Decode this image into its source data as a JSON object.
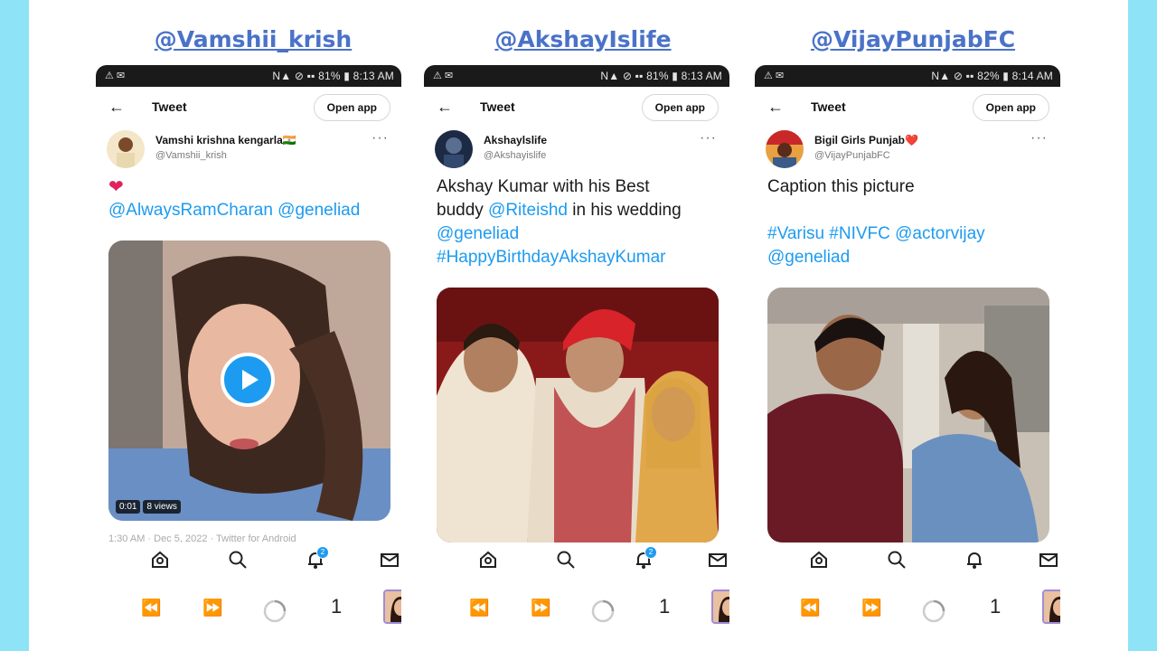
{
  "accent_color": "#1d9bf0",
  "handles": [
    "@Vamshii_krish",
    "@AkshayIslife",
    "@VijayPunjabFC"
  ],
  "phones": [
    {
      "status": {
        "left": "⚠ ✉",
        "right": "N▲ ⊘ ▪▪ 81% ▮ 8:13 AM"
      },
      "topbar": {
        "title": "Tweet",
        "open_app": "Open app"
      },
      "author": {
        "name": "Vamshi krishna kengarla🇮🇳",
        "handle": "@Vamshii_krish"
      },
      "text": {
        "heart": "❤",
        "line1": "@AlwaysRamCharan  @geneliad"
      },
      "video": {
        "duration": "0:01",
        "views": "8 views"
      },
      "timestamp": "1:30 AM · Dec 5, 2022 · Twitter for Android",
      "nav": {
        "notif_count": "2"
      },
      "system": {
        "count": "1"
      }
    },
    {
      "status": {
        "left": "⚠ ✉",
        "right": "N▲ ⊘ ▪▪ 81% ▮ 8:13 AM"
      },
      "topbar": {
        "title": "Tweet",
        "open_app": "Open app"
      },
      "author": {
        "name": "Akshaylslife",
        "handle": "@Akshayislife"
      },
      "text": {
        "line1": "Akshay Kumar with his Best",
        "line2a": "buddy ",
        "line2b": "@Riteishd",
        "line2c": " in his wedding",
        "line3": "@geneliad",
        "line4": "#HappyBirthdayAkshayKumar"
      },
      "nav": {
        "notif_count": "2"
      },
      "system": {
        "count": "1"
      }
    },
    {
      "status": {
        "left": "⚠ ✉",
        "right": "N▲ ⊘ ▪▪ 82% ▮ 8:14 AM"
      },
      "topbar": {
        "title": "Tweet",
        "open_app": "Open app"
      },
      "author": {
        "name": "Bigil Girls Punjab❤️",
        "handle": "@VijayPunjabFC"
      },
      "text": {
        "line1": "Caption this picture",
        "line3": "#Varisu #NIVFC @actorvijay",
        "line4": "@geneliad"
      },
      "system": {
        "count": "1"
      }
    }
  ]
}
